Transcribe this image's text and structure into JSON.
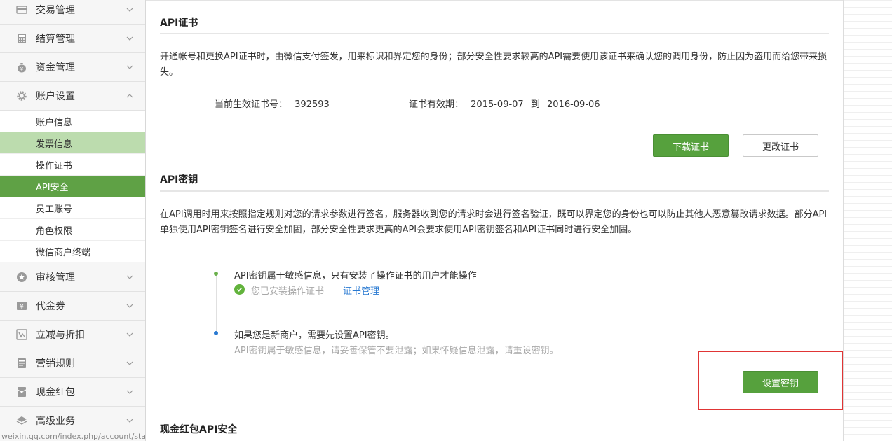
{
  "sidebar": {
    "groups": [
      {
        "label": "交易管理",
        "icon": "card-icon"
      },
      {
        "label": "结算管理",
        "icon": "calculator-icon"
      },
      {
        "label": "资金管理",
        "icon": "money-bag-icon"
      },
      {
        "label": "账户设置",
        "icon": "gear-icon"
      },
      {
        "label": "审核管理",
        "icon": "star-icon"
      },
      {
        "label": "代金券",
        "icon": "yen-icon"
      },
      {
        "label": "立减与折扣",
        "icon": "discount-icon"
      },
      {
        "label": "营销规则",
        "icon": "document-icon"
      },
      {
        "label": "现金红包",
        "icon": "red-packet-icon"
      },
      {
        "label": "高级业务",
        "icon": "layers-icon"
      }
    ],
    "account_items": [
      {
        "label": "账户信息"
      },
      {
        "label": "发票信息"
      },
      {
        "label": "操作证书"
      },
      {
        "label": "API安全"
      },
      {
        "label": "员工账号"
      },
      {
        "label": "角色权限"
      },
      {
        "label": "微信商户终端"
      }
    ],
    "active_item": "API安全",
    "hover_item": "发票信息",
    "status_url": "weixin.qq.com/index.php/account/staff_account"
  },
  "cert": {
    "title": "API证书",
    "desc": "开通帐号和更换API证书时，由微信支付签发，用来标识和界定您的身份；部分安全性要求较高的API需要使用该证书来确认您的调用身份，防止因为盗用而给您带来损失。",
    "serial_label": "当前生效证书号：",
    "serial_value": "392593",
    "validity_label": "证书有效期：",
    "validity_from": "2015-09-07",
    "validity_to_word": "到",
    "validity_to": "2016-09-06",
    "download_button": "下载证书",
    "change_button": "更改证书"
  },
  "key": {
    "title": "API密钥",
    "desc": "在API调用时用来按照指定规则对您的请求参数进行签名，服务器收到您的请求时会进行签名验证，既可以界定您的身份也可以防止其他人恶意篡改请求数据。部分API单独使用API密钥签名进行安全加固，部分安全性要求更高的API会要求使用API密钥签名和API证书同时进行安全加固。",
    "step1_text": "API密钥属于敏感信息，只有安装了操作证书的用户才能操作",
    "step1_status": "您已安装操作证书",
    "step1_link": "证书管理",
    "step2_text": "如果您是新商户，需要先设置API密钥。",
    "step2_hint": "API密钥属于敏感信息，请妥善保管不要泄露；如果怀疑信息泄露，请重设密钥。",
    "set_button": "设置密钥"
  },
  "redpacket": {
    "title": "现金红包API安全"
  },
  "colors": {
    "brand_green": "#56a13d",
    "active_green": "#5fa145",
    "highlight_green": "#bcdcae",
    "link_blue": "#2a7ad2",
    "annotation_red": "#e03535"
  }
}
